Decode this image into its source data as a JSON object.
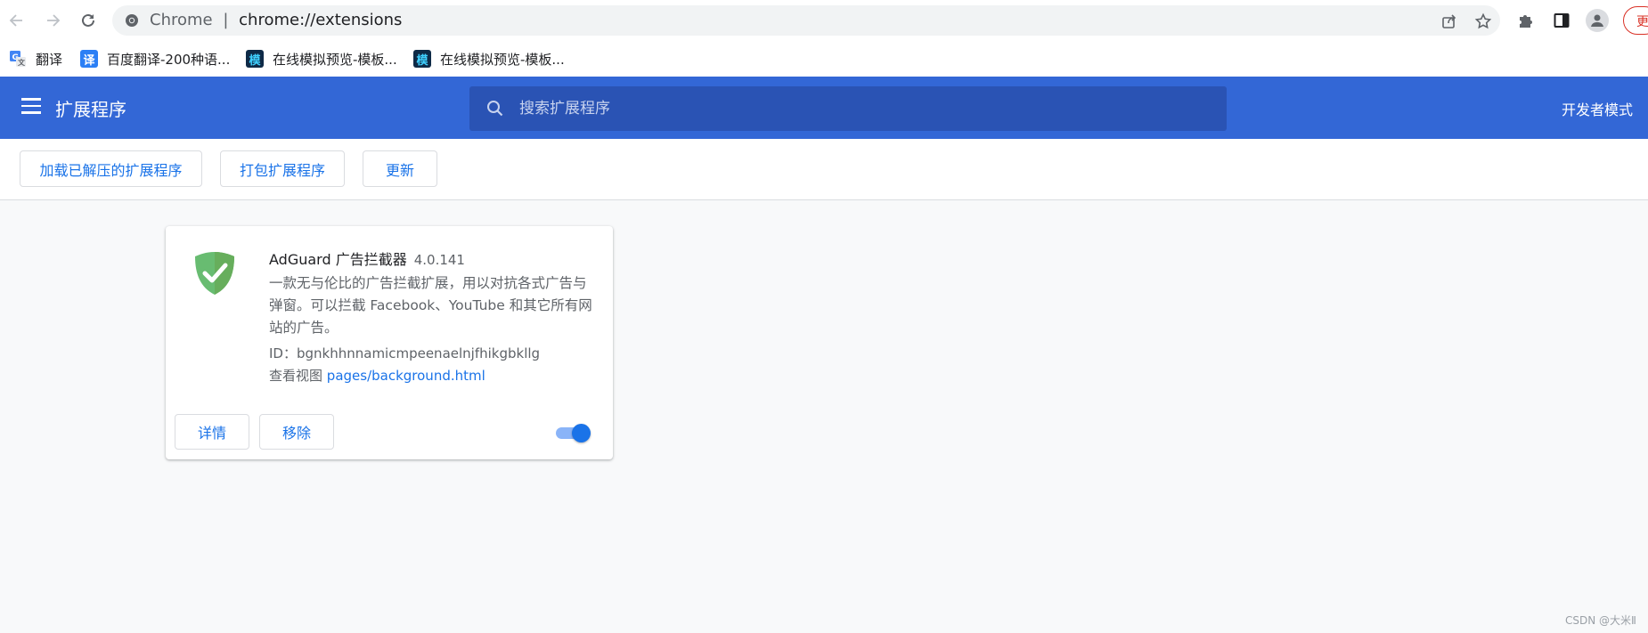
{
  "browser": {
    "omnibox_prefix": "Chrome",
    "omnibox_separator": "|",
    "url": "chrome://extensions",
    "update_label": "更"
  },
  "bookmarks": [
    {
      "label": "翻译",
      "icon": "google-translate-icon"
    },
    {
      "label": "百度翻译-200种语...",
      "icon": "baidu-translate-icon",
      "icon_text": "译"
    },
    {
      "label": "在线模拟预览-模板...",
      "icon": "template-icon",
      "icon_text": "模"
    },
    {
      "label": "在线模拟预览-模板...",
      "icon": "template-icon",
      "icon_text": "模"
    }
  ],
  "header": {
    "title": "扩展程序",
    "search_placeholder": "搜索扩展程序",
    "dev_mode_label": "开发者模式"
  },
  "actions": {
    "load_unpacked": "加载已解压的扩展程序",
    "pack": "打包扩展程序",
    "update": "更新"
  },
  "extension": {
    "name": "AdGuard 广告拦截器",
    "version": "4.0.141",
    "description": "一款无与伦比的广告拦截扩展，用以对抗各式广告与弹窗。可以拦截 Facebook、YouTube 和其它所有网站的广告。",
    "id_label": "ID：",
    "id": "bgnkhhnnamicmpeenaelnjfhikgbkllg",
    "views_label": "查看视图",
    "view_link": "pages/background.html",
    "details_label": "详情",
    "remove_label": "移除",
    "enabled": true
  },
  "watermark": "CSDN @大米Ⅱ",
  "colors": {
    "header_blue": "#3367d6",
    "accent": "#1a73e8",
    "adguard_green": "#68bc71"
  }
}
